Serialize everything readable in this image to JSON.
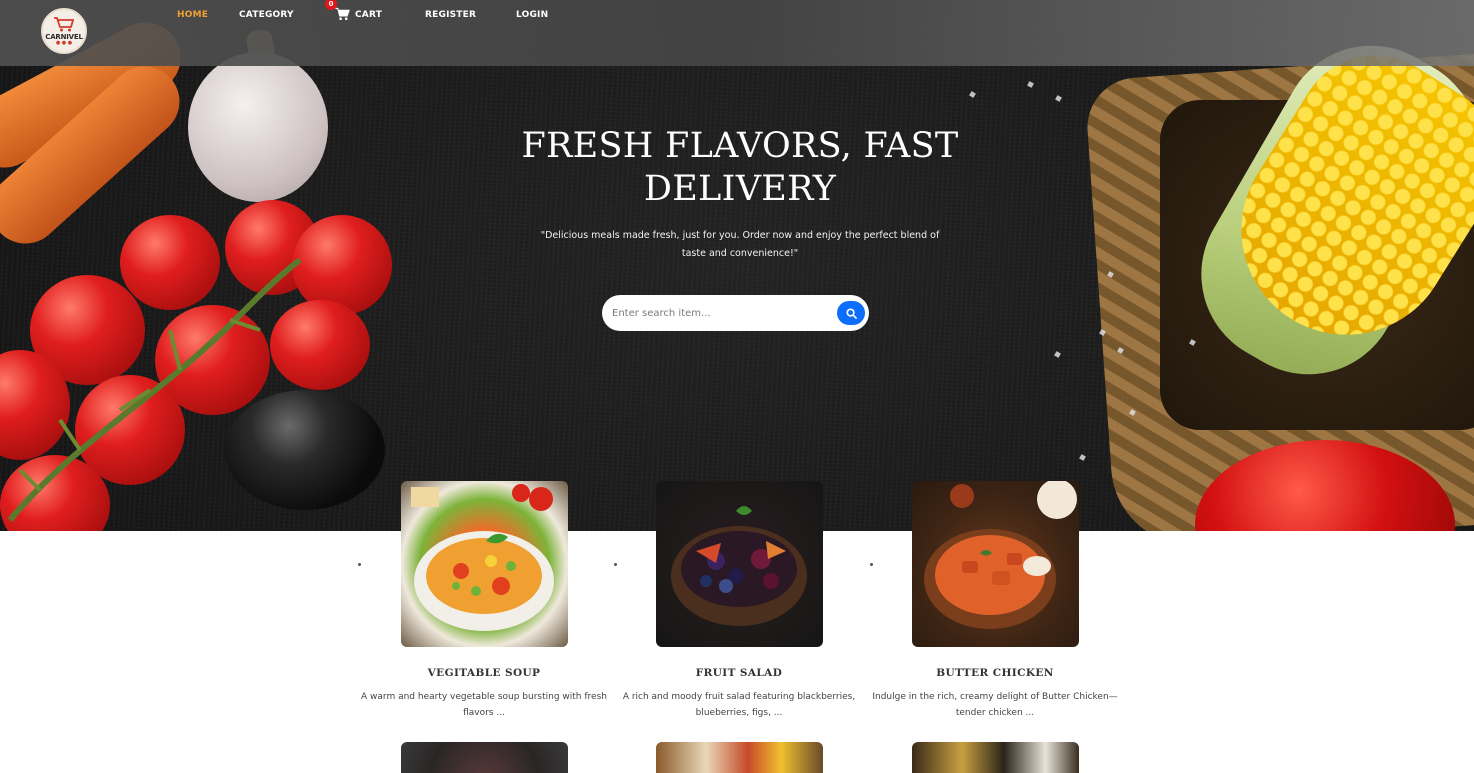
{
  "nav": {
    "logo_text": "CARNIVEL",
    "items": [
      {
        "label": "HOME",
        "active": true
      },
      {
        "label": "CATEGORY",
        "active": false
      },
      {
        "label": "CART",
        "active": false
      },
      {
        "label": "REGISTER",
        "active": false
      },
      {
        "label": "LOGIN",
        "active": false
      }
    ],
    "cart_count": "0",
    "cart_icon": "cart-icon"
  },
  "hero": {
    "title": "FRESH FLAVORS, FAST DELIVERY",
    "subtitle": "\"Delicious meals made fresh, just for you. Order now and enjoy the perfect blend of taste and convenience!\"",
    "search_placeholder": "Enter search item...",
    "search_icon": "search-icon"
  },
  "products": [
    {
      "name": "VEGITABLE SOUP",
      "description": "A warm and hearty vegetable soup bursting with fresh flavors ..."
    },
    {
      "name": "FRUIT SALAD",
      "description": "A rich and moody fruit salad featuring blackberries, blueberries, figs, ..."
    },
    {
      "name": "BUTTER CHICKEN",
      "description": "Indulge in the rich, creamy delight of Butter Chicken—tender chicken ..."
    }
  ],
  "colors": {
    "accent_active": "#f0a030",
    "badge": "#e0181b",
    "search_button": "#0d6efd"
  }
}
